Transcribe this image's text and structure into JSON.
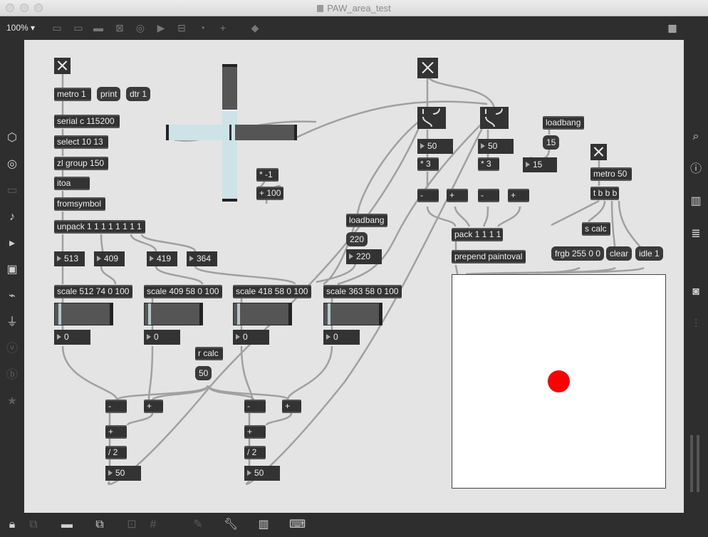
{
  "window": {
    "title": "PAW_area_test"
  },
  "toolbar": {
    "zoom": "100% ▾"
  },
  "patch": {
    "objects": {
      "metro1": "metro 1",
      "serial": "serial c 115200",
      "select": "select 10 13",
      "zlgroup": "zl group 150",
      "itoa": "itoa",
      "fromsymbol": "fromsymbol",
      "unpack": "unpack 1 1 1 1 1 1 1 1",
      "mulneg": "* -1",
      "plus100": "+ 100",
      "loadbang_mid": "loadbang",
      "scale1": "scale 512 74 0 100",
      "scale2": "scale 409 58 0 100",
      "scale3": "scale 418 58 0 100",
      "scale4": "scale 363 58 0 100",
      "rcalc": "r calc",
      "minus1": "-",
      "plus1": "+",
      "plus1b": "+",
      "div1": "/ 2",
      "minus2": "-",
      "plus2": "+",
      "plus2b": "+",
      "div2": "/ 2",
      "mul3a": "* 3",
      "mul3b": "* 3",
      "loadbang_right": "loadbang",
      "metro50": "metro 50",
      "tbbb": "t b b b",
      "r_minus1": "-",
      "r_plus1": "+",
      "r_minus2": "-",
      "r_plus2": "+",
      "scalc": "s calc",
      "pack": "pack 1 1 1 1",
      "prepend": "prepend paintoval"
    },
    "messages": {
      "print": "print",
      "dtr1": "dtr 1",
      "m220": "220",
      "m50": "50",
      "m15": "15",
      "frgb": "frgb 255 0 0",
      "clear": "clear",
      "idle": "idle 1"
    },
    "numbers": {
      "n513": "513",
      "n409": "409",
      "n419": "419",
      "n364": "364",
      "n220": "220",
      "out1": "0",
      "out2": "0",
      "out3": "0",
      "out4": "0",
      "res1": "50",
      "res2": "50",
      "g50a": "50",
      "g50b": "50",
      "n15": "15"
    }
  },
  "colors": {
    "dot": "#ff0000",
    "canvas": "#e4e4e4",
    "object": "#333333",
    "cross_slider": "#cde3e8"
  }
}
